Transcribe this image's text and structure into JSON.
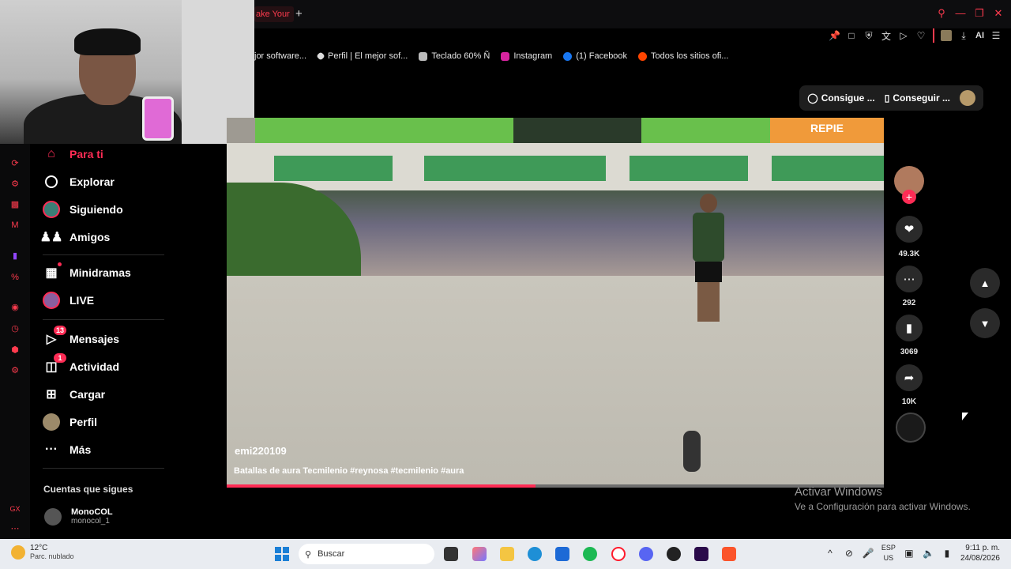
{
  "browser": {
    "active_tab_title": "ake Your",
    "new_tab_symbol": "+",
    "window_controls": [
      "search-icon",
      "minimize-icon",
      "maximize-icon",
      "close-icon"
    ],
    "toolbar_ai_label": "AI",
    "accent": "#ff3b4e"
  },
  "bookmarks": [
    {
      "label": "jor software...",
      "icon": "generic-icon",
      "color": "#333333"
    },
    {
      "label": "Perfil | El mejor sof...",
      "icon": "diamond-icon",
      "color": "#dddddd"
    },
    {
      "label": "Teclado 60% Ñ",
      "icon": "keyboard-icon",
      "color": "#bbbbbb"
    },
    {
      "label": "Instagram",
      "icon": "instagram-icon",
      "color": "#d6249f"
    },
    {
      "label": "(1) Facebook",
      "icon": "facebook-icon",
      "color": "#1877f2"
    },
    {
      "label": "Todos los sitios ofi...",
      "icon": "reddit-icon",
      "color": "#ff4500"
    }
  ],
  "nav": {
    "items": [
      {
        "label": "Para ti",
        "icon": "home-icon",
        "active": true
      },
      {
        "label": "Explorar",
        "icon": "compass-icon"
      },
      {
        "label": "Siguiendo",
        "icon": "following-avatar-icon"
      },
      {
        "label": "Amigos",
        "icon": "friends-icon"
      },
      {
        "label": "Minidramas",
        "icon": "film-icon"
      },
      {
        "label": "LIVE",
        "icon": "live-icon"
      },
      {
        "label": "Mensajes",
        "icon": "messages-icon",
        "badge": "13"
      },
      {
        "label": "Actividad",
        "icon": "activity-icon",
        "badge": "1"
      },
      {
        "label": "Cargar",
        "icon": "upload-icon"
      },
      {
        "label": "Perfil",
        "icon": "profile-avatar-icon"
      },
      {
        "label": "Más",
        "icon": "more-icon"
      }
    ],
    "following_title": "Cuentas que sigues",
    "following_accounts": [
      {
        "name": "MonoCOL",
        "handle": "monocol_1"
      }
    ],
    "active_color": "#fe2c55"
  },
  "promo": {
    "button1": "Consigue ...",
    "button2": "Conseguir ..."
  },
  "video": {
    "username": "emi220109",
    "caption": "Batallas de aura Tecmilenio #reynosa #tecmilenio #aura",
    "progress_fraction": 0.47,
    "sign_text": "REPIE"
  },
  "actions": {
    "likes": "49.3K",
    "comments": "292",
    "saves": "3069",
    "shares": "10K"
  },
  "activate_windows": {
    "title": "Activar Windows",
    "subtitle": "Ve a Configuración para activar Windows."
  },
  "taskbar": {
    "weather_temp": "12°C",
    "weather_desc": "Parc. nublado",
    "search_placeholder": "Buscar",
    "lang_top": "ESP",
    "lang_bottom": "US",
    "time": "9:11 p. m.",
    "date": "24/08/2026"
  }
}
